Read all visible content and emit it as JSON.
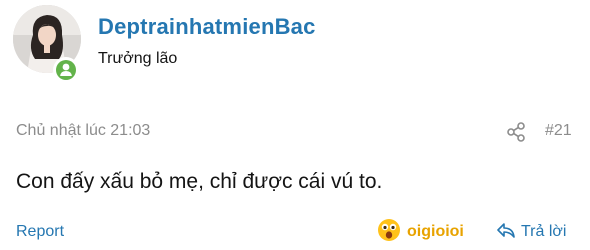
{
  "author": {
    "username": "DeptrainhatmienBac",
    "title": "Trưởng lão",
    "status": "online"
  },
  "post": {
    "date": "Chủ nhật lúc 21:03",
    "number": "#21",
    "message": "Con đấy xấu bỏ mẹ, chỉ được cái vú to."
  },
  "actions": {
    "report_label": "Report",
    "reaction_label": "oigioioi",
    "reply_label": "Trả lời"
  },
  "colors": {
    "link": "#2577b1",
    "muted": "#8c8c8c",
    "online": "#63b34a",
    "reaction": "#e8a300"
  },
  "icons": [
    "share-icon",
    "reaction-emoji-icon",
    "reply-icon",
    "online-status-icon"
  ]
}
